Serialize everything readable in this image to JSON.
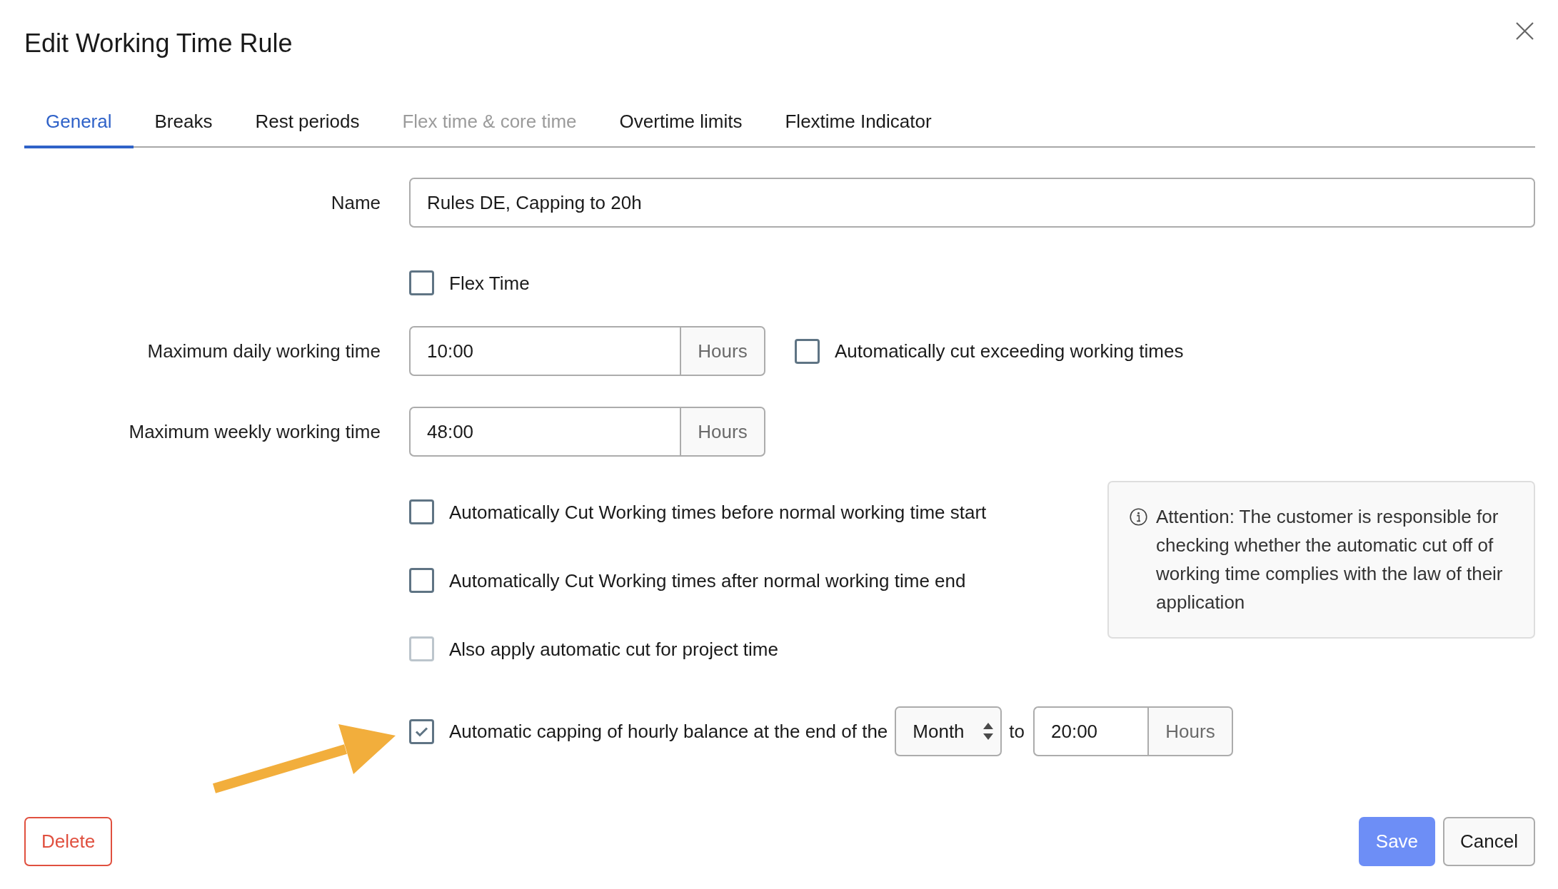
{
  "dialog": {
    "title": "Edit Working Time Rule"
  },
  "tabs": [
    {
      "label": "General",
      "selected": true,
      "disabled": false
    },
    {
      "label": "Breaks",
      "selected": false,
      "disabled": false
    },
    {
      "label": "Rest periods",
      "selected": false,
      "disabled": false
    },
    {
      "label": "Flex time & core time",
      "selected": false,
      "disabled": true
    },
    {
      "label": "Overtime limits",
      "selected": false,
      "disabled": false
    },
    {
      "label": "Flextime Indicator",
      "selected": false,
      "disabled": false
    }
  ],
  "form": {
    "name": {
      "label": "Name",
      "value": "Rules DE, Capping to 20h"
    },
    "flex_time": {
      "label": "Flex Time",
      "checked": false
    },
    "max_daily": {
      "label": "Maximum daily working time",
      "value": "10:00",
      "unit": "Hours",
      "auto_cut": {
        "label": "Automatically cut exceeding working times",
        "checked": false
      }
    },
    "max_weekly": {
      "label": "Maximum weekly working time",
      "value": "48:00",
      "unit": "Hours"
    },
    "cut_options": [
      {
        "label": "Automatically Cut Working times before normal working time start",
        "checked": false,
        "disabled": false
      },
      {
        "label": "Automatically Cut Working times after normal working time end",
        "checked": false,
        "disabled": false
      },
      {
        "label": "Also apply automatic cut for project time",
        "checked": false,
        "disabled": true
      }
    ],
    "notice": {
      "text": "Attention: The customer is responsible for checking whether the automatic cut off of working time complies with the law of their application"
    },
    "capping": {
      "label": "Automatic capping of hourly balance at the end of the",
      "checked": true,
      "period": "Month",
      "connector": "to",
      "value": "20:00",
      "unit": "Hours"
    }
  },
  "buttons": [
    {
      "label": "Delete",
      "kind": "danger"
    },
    {
      "label": "Save",
      "kind": "primary"
    },
    {
      "label": "Cancel",
      "kind": "secondary"
    }
  ]
}
